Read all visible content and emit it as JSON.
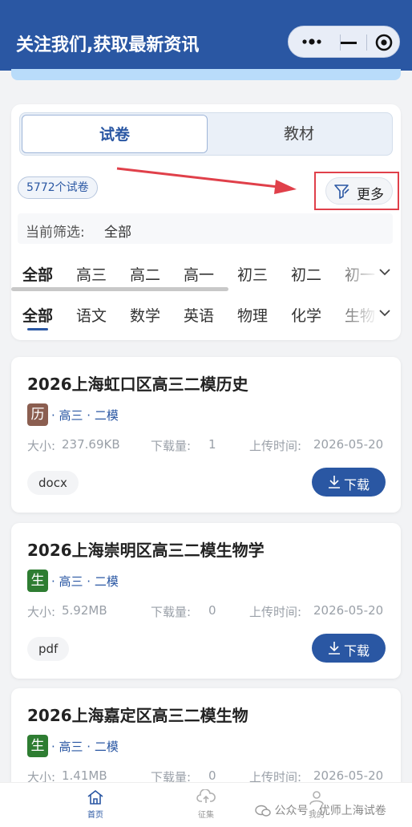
{
  "header": {
    "title": "关注我们,获取最新资讯"
  },
  "segments": {
    "active": "试卷",
    "inactive": "教材"
  },
  "filter": {
    "count": "5772个试卷",
    "more_label": "更多",
    "current_label": "当前筛选:",
    "current_value": "全部"
  },
  "grade_tabs": [
    "全部",
    "高三",
    "高二",
    "高一",
    "初三",
    "初二",
    "初一"
  ],
  "subject_tabs": [
    "全部",
    "语文",
    "数学",
    "英语",
    "物理",
    "化学",
    "生物"
  ],
  "stat_labels": {
    "size": "大小:",
    "downloads": "下载量:",
    "upload": "上传时间:"
  },
  "download_label": "下载",
  "papers": [
    {
      "title": "2026上海虹口区高三二模历史",
      "subject": "历",
      "subject_color": "#8b5e50",
      "meta": "· 高三 · 二模",
      "size": "237.69KB",
      "downloads": "1",
      "upload": "2026-05-20",
      "format": "docx"
    },
    {
      "title": "2026上海崇明区高三二模生物学",
      "subject": "生",
      "subject_color": "#2e7d32",
      "meta": "· 高三 · 二模",
      "size": "5.92MB",
      "downloads": "0",
      "upload": "2026-05-20",
      "format": "pdf"
    },
    {
      "title": "2026上海嘉定区高三二模生物",
      "subject": "生",
      "subject_color": "#2e7d32",
      "meta": "· 高三 · 二模",
      "size": "1.41MB",
      "downloads": "0",
      "upload": "2026-05-20",
      "format": ""
    }
  ],
  "bottom_nav": [
    {
      "label": "首页",
      "icon": "home-icon",
      "active": true
    },
    {
      "label": "征集",
      "icon": "cloud-upload-icon",
      "active": false
    },
    {
      "label": "我的",
      "icon": "user-icon",
      "active": false
    }
  ],
  "watermark": {
    "text": "公众号 · 优师上海试卷"
  },
  "colors": {
    "primary": "#2a57a3",
    "annotation": "#e0404a"
  }
}
